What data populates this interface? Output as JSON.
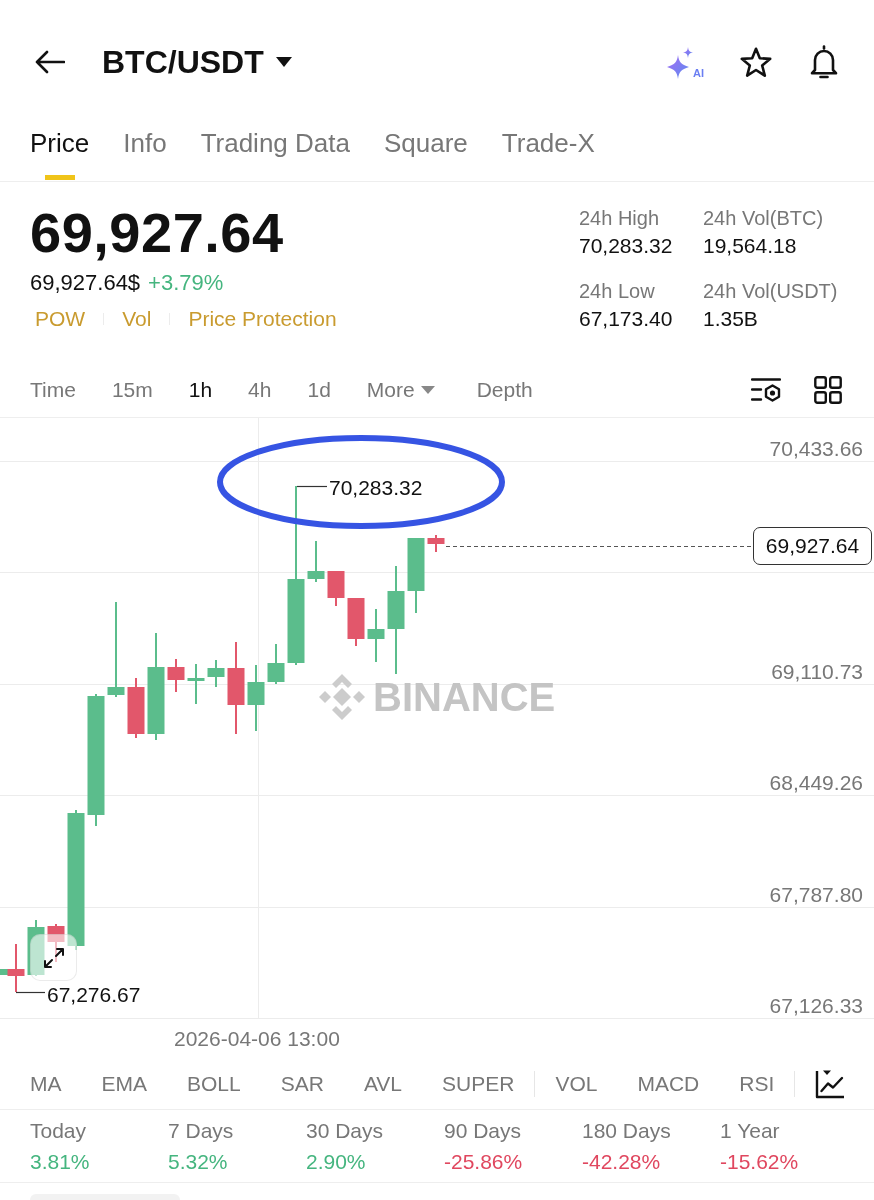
{
  "header": {
    "pair": "BTC/USDT",
    "ai_label": "AI",
    "favorited": false
  },
  "tabs": [
    {
      "label": "Price",
      "selected": true
    },
    {
      "label": "Info",
      "selected": false
    },
    {
      "label": "Trading Data",
      "selected": false
    },
    {
      "label": "Square",
      "selected": false
    },
    {
      "label": "Trade-X",
      "selected": false
    }
  ],
  "price": {
    "last": "69,927.64",
    "usd": "69,927.64$",
    "change": "+3.79%",
    "negative": false,
    "tags": [
      "POW",
      "Vol",
      "Price Protection"
    ]
  },
  "stats": [
    {
      "label": "24h High",
      "value": "70,283.32"
    },
    {
      "label": "24h Vol(BTC)",
      "value": "19,564.18"
    },
    {
      "label": "24h Low",
      "value": "67,173.40"
    },
    {
      "label": "24h Vol(USDT)",
      "value": "1.35B"
    }
  ],
  "intervals": [
    {
      "label": "Time",
      "kind": "option",
      "selected": false
    },
    {
      "label": "15m",
      "kind": "option",
      "selected": false
    },
    {
      "label": "1h",
      "kind": "option",
      "selected": true
    },
    {
      "label": "4h",
      "kind": "option",
      "selected": false
    },
    {
      "label": "1d",
      "kind": "option",
      "selected": false
    },
    {
      "label": "More",
      "kind": "dropdown",
      "selected": false
    },
    {
      "label": "Depth",
      "kind": "view",
      "selected": false
    }
  ],
  "chart": {
    "price_axis": [
      "70,433.66",
      "69,110.73",
      "68,449.26",
      "67,787.80",
      "67,126.33"
    ],
    "high_label": "70,283.32",
    "low_label": "67,276.67",
    "last_price": "69,927.64",
    "time_label": "2026-04-06 13:00",
    "watermark": "BINANCE"
  },
  "indicators": [
    {
      "items": [
        "MA",
        "EMA",
        "BOLL",
        "SAR",
        "AVL",
        "SUPER"
      ]
    },
    {
      "items": [
        "VOL",
        "MACD",
        "RSI"
      ]
    }
  ],
  "performance": [
    {
      "period": "Today",
      "change": "3.81%",
      "negative": false
    },
    {
      "period": "7 Days",
      "change": "5.32%",
      "negative": false
    },
    {
      "period": "30 Days",
      "change": "2.90%",
      "negative": false
    },
    {
      "period": "90 Days",
      "change": "-25.86%",
      "negative": true
    },
    {
      "period": "180 Days",
      "change": "-42.28%",
      "negative": true
    },
    {
      "period": "1 Year",
      "change": "-15.62%",
      "negative": true
    }
  ]
}
